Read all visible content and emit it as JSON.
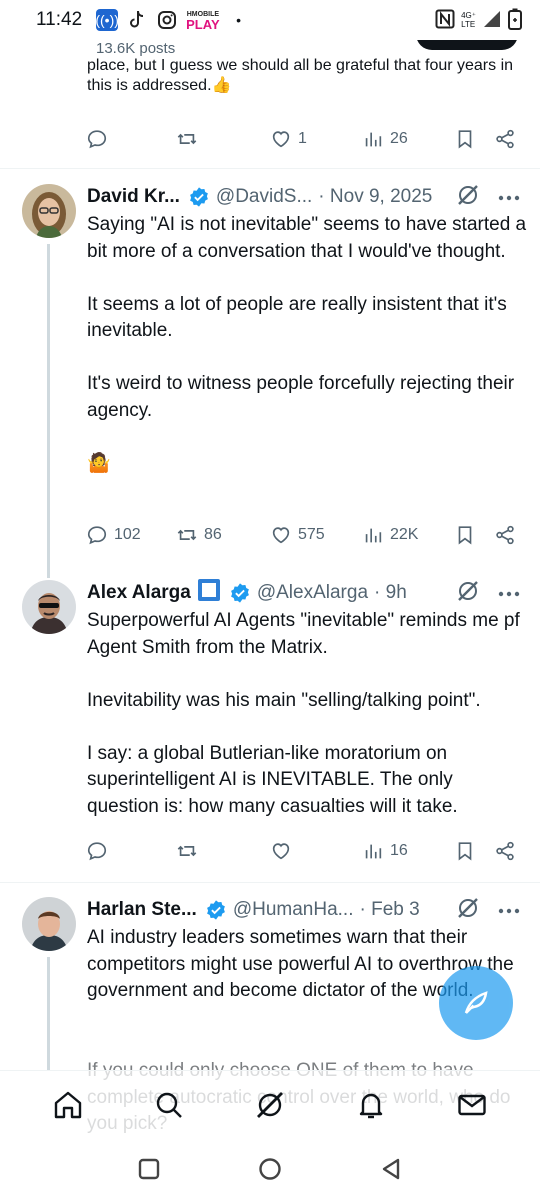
{
  "status_bar": {
    "time": "11:42",
    "icons": [
      "radio-icon",
      "tiktok-icon",
      "instagram-icon",
      "hoopla-icon",
      "dot-icon"
    ],
    "play_label_top": "HMOBILE",
    "play_label_bottom": "PLAY",
    "dot": "•",
    "right_icons": [
      "nfc-icon",
      "lte-icon",
      "signal-icon",
      "battery-icon"
    ],
    "network": "4G⁺\nLTE"
  },
  "top_tweet": {
    "meta": "13.6K posts",
    "text": "place, but I guess we should all be grateful that four years in this is addressed.👍",
    "likes": "1",
    "views": "26"
  },
  "tweets": [
    {
      "name": "David Kr...",
      "handle": "@DavidS...",
      "date": "· Nov 9, 2025",
      "text": "Saying \"AI is not inevitable\" seems to have started a bit more of a conversation that I would've thought.\n\nIt seems a lot of people are really insistent that it's inevitable.\n\nIt's weird to witness people forcefully rejecting their agency.\n\n🤷",
      "replies": "102",
      "retweets": "86",
      "likes": "575",
      "views": "22K"
    },
    {
      "name": "Alex Alarga",
      "name_badge": "🔲",
      "handle": "@AlexAlarga",
      "date": "· 9h",
      "text": "Superpowerful AI Agents \"inevitable\" reminds me pf Agent Smith from the Matrix.\n\nInevitability was his main \"selling/talking point\".\n\nI say: a global Butlerian-like moratorium on superintelligent AI is INEVITABLE. The only question is: how many casualties will it take.",
      "replies": "",
      "retweets": "",
      "likes": "",
      "views": "16"
    },
    {
      "name": "Harlan Ste...",
      "handle": "@HumanHa...",
      "date": "· Feb 3",
      "text": "AI industry leaders sometimes warn that their competitors might use powerful AI to overthrow the government and become dictator of the world."
    }
  ],
  "overlay_text": "If you could only choose ONE of them to have complete autocratic control over the world, who do you pick?",
  "bottom_nav": [
    "home-icon",
    "search-icon",
    "grok-icon",
    "notifications-icon",
    "messages-icon"
  ],
  "fab": "compose-icon",
  "system_nav": [
    "recents-icon",
    "home-circle-icon",
    "back-icon"
  ],
  "colors": {
    "accent": "#1d9bf0",
    "text": "#0f1419",
    "secondary": "#536471",
    "divider": "#eff3f4",
    "thread": "#cfd9de"
  }
}
